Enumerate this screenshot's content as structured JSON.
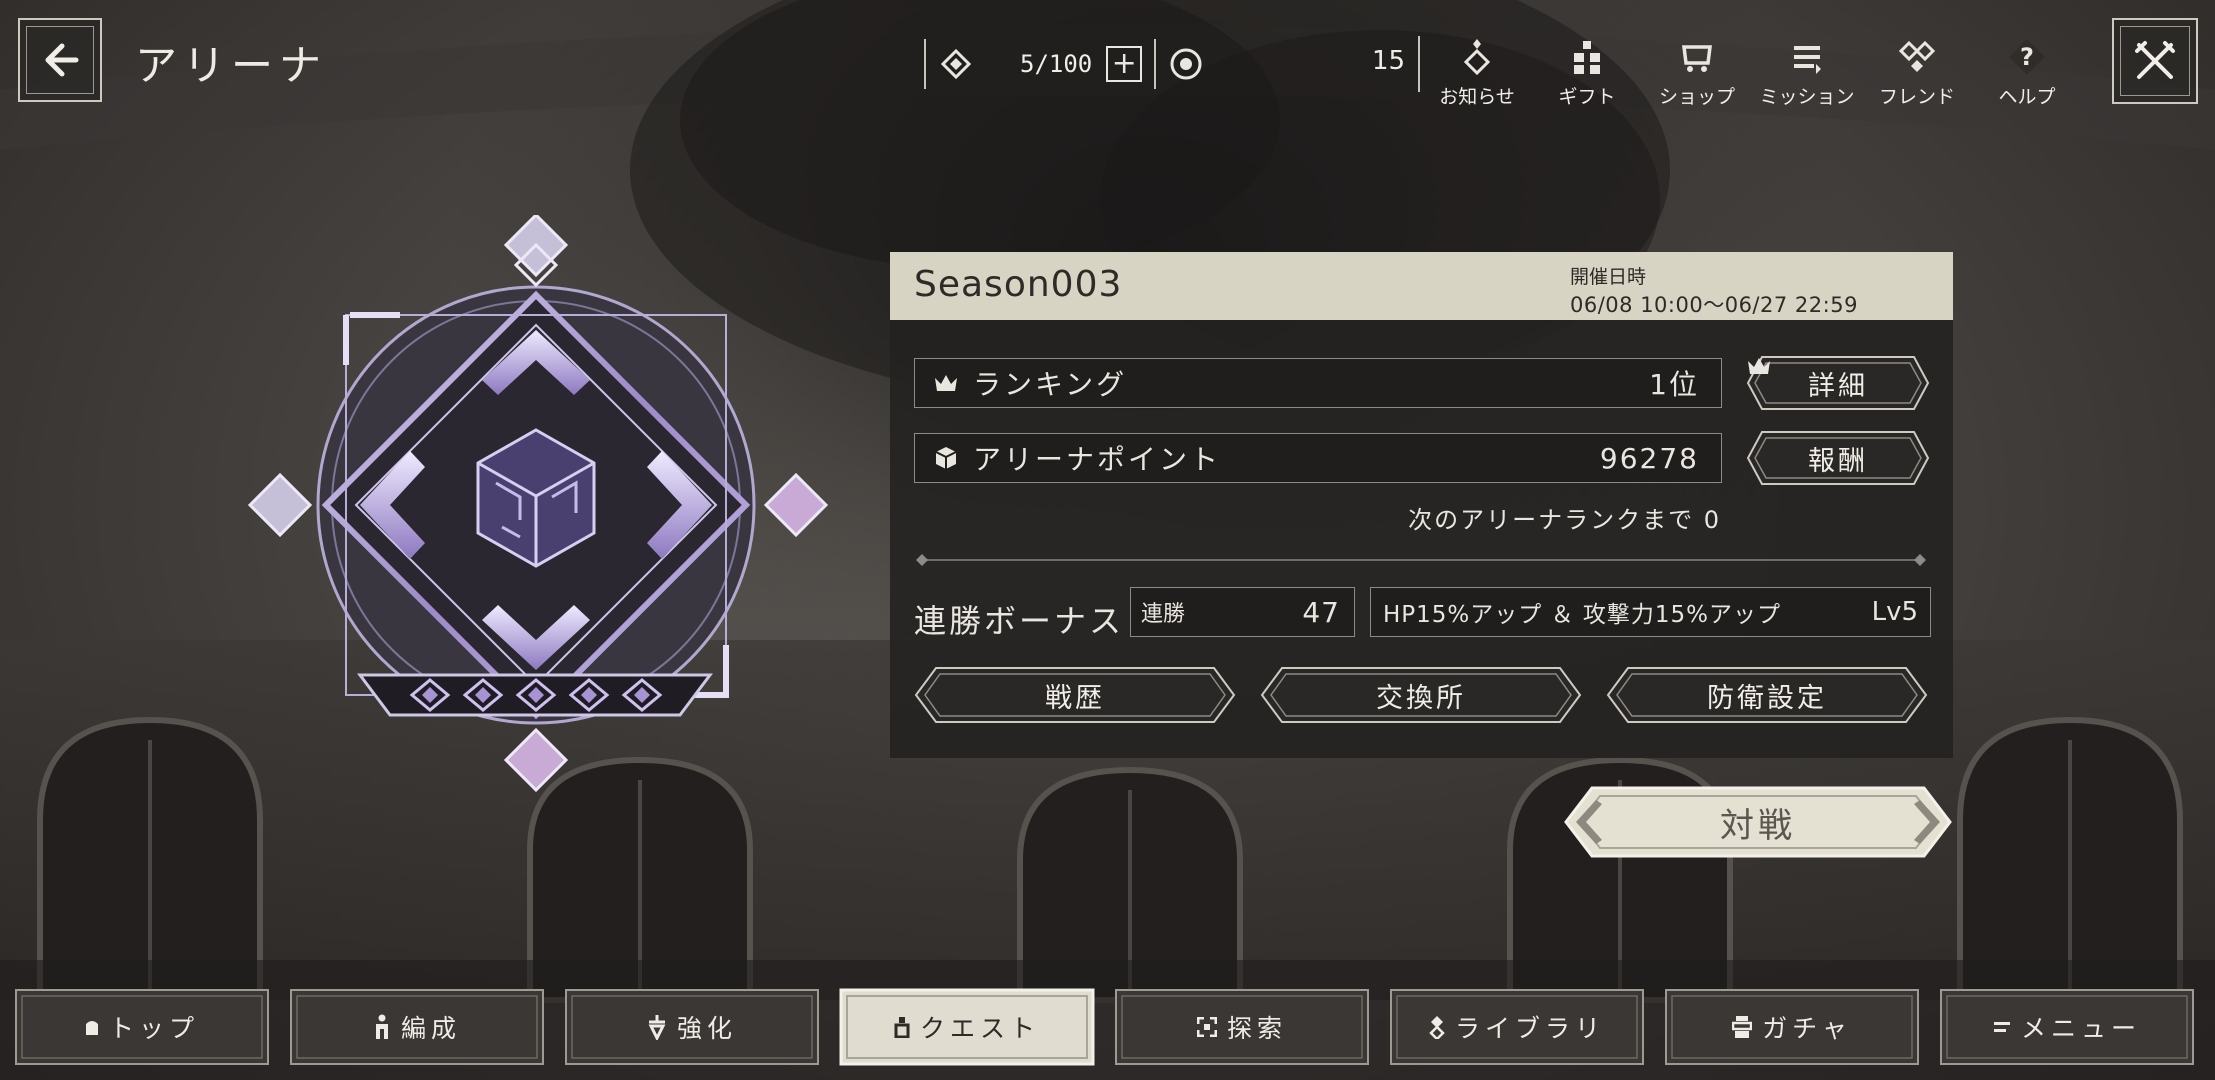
{
  "header": {
    "title": "アリーナ",
    "back_icon": "back-arrow-icon",
    "close_icon": "crossed-swords-icon",
    "stamina": "5/100",
    "count": "15"
  },
  "top_menu": [
    {
      "label": "お知らせ",
      "icon": "notice-icon"
    },
    {
      "label": "ギフト",
      "icon": "gift-icon"
    },
    {
      "label": "ショップ",
      "icon": "shop-icon"
    },
    {
      "label": "ミッション",
      "icon": "mission-icon"
    },
    {
      "label": "フレンド",
      "icon": "friend-icon"
    },
    {
      "label": "ヘルプ",
      "icon": "help-icon"
    }
  ],
  "panel": {
    "season": "Season003",
    "datetime_label": "開催日時",
    "datetime_value": "06/08 10:00～06/27 22:59",
    "ranking_label": "ランキング",
    "ranking_value": "1位",
    "detail_button": "詳細",
    "points_label": "アリーナポイント",
    "points_value": "96278",
    "reward_button": "報酬",
    "next_rank": "次のアリーナランクまで 0",
    "bonus_label": "連勝ボーナス",
    "streak_key": "連勝",
    "streak_value": "47",
    "bonus_text": "HP15%アップ ＆ 攻撃力15%アップ",
    "bonus_level": "Lv5",
    "history_button": "戦歴",
    "exchange_button": "交換所",
    "defense_button": "防衛設定"
  },
  "battle_button": "対戦",
  "colors": {
    "accent": "#b9a3e0",
    "panel_header": "#d8d4c4",
    "panel_bg": "#242221",
    "button_cream": "#e4e0d2"
  },
  "bottom_nav": [
    {
      "label": "トップ",
      "icon": "home-icon"
    },
    {
      "label": "編成",
      "icon": "formation-icon"
    },
    {
      "label": "強化",
      "icon": "upgrade-icon"
    },
    {
      "label": "クエスト",
      "icon": "quest-icon",
      "active": true
    },
    {
      "label": "探索",
      "icon": "explore-icon"
    },
    {
      "label": "ライブラリ",
      "icon": "library-icon"
    },
    {
      "label": "ガチャ",
      "icon": "gacha-icon"
    },
    {
      "label": "メニュー",
      "icon": "menu-icon"
    }
  ]
}
